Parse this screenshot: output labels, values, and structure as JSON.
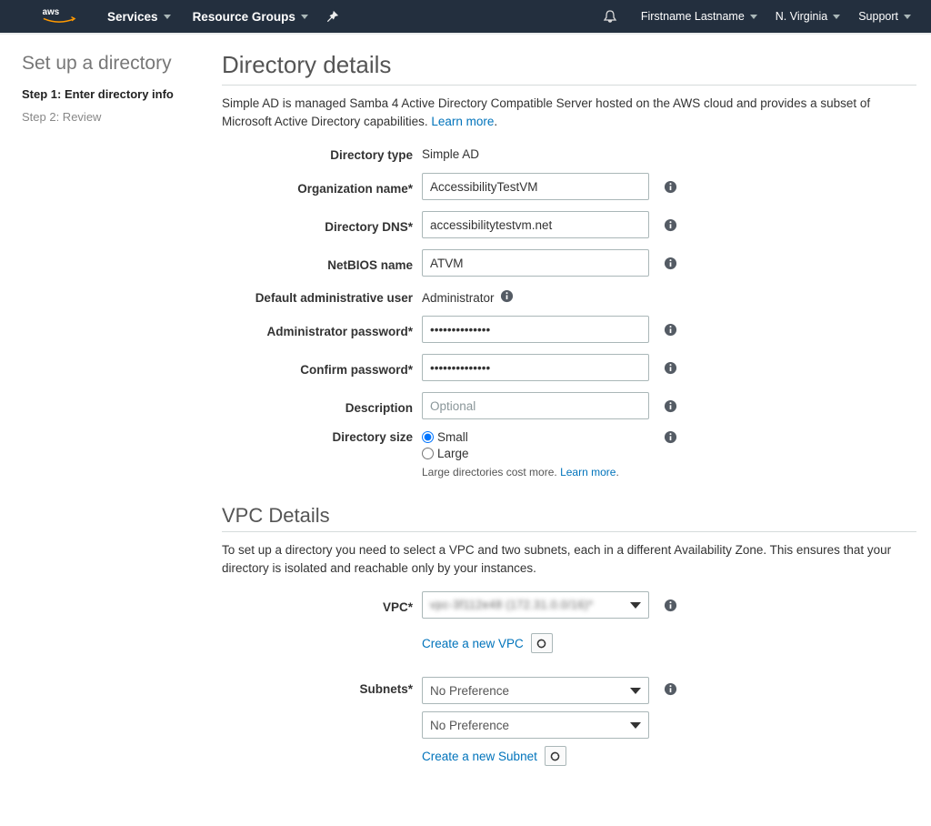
{
  "nav": {
    "services": "Services",
    "resource_groups": "Resource Groups",
    "user": "Firstname Lastname",
    "region": "N. Virginia",
    "support": "Support"
  },
  "sidebar": {
    "title": "Set up a directory",
    "steps": [
      {
        "label": "Step 1: Enter directory info"
      },
      {
        "label": "Step 2: Review"
      }
    ]
  },
  "main": {
    "heading": "Directory details",
    "intro": "Simple AD is managed Samba 4 Active Directory Compatible Server hosted on the AWS cloud and provides a subset of Microsoft Active Directory capabilities. ",
    "learn_more": "Learn more",
    "fields": {
      "directory_type_label": "Directory type",
      "directory_type_value": "Simple AD",
      "org_name_label": "Organization name*",
      "org_name_value": "AccessibilityTestVM",
      "dns_label": "Directory DNS*",
      "dns_value": "accessibilitytestvm.net",
      "netbios_label": "NetBIOS name",
      "netbios_value": "ATVM",
      "admin_user_label": "Default administrative user",
      "admin_user_value": "Administrator",
      "admin_pass_label": "Administrator password*",
      "admin_pass_value": "••••••••••••••",
      "confirm_pass_label": "Confirm password*",
      "confirm_pass_value": "••••••••••••••",
      "description_label": "Description",
      "description_placeholder": "Optional",
      "dir_size_label": "Directory size",
      "size_small": "Small",
      "size_large": "Large",
      "size_note_prefix": "Large directories cost more. ",
      "size_note_link": "Learn more"
    },
    "vpc": {
      "heading": "VPC Details",
      "intro": "To set up a directory you need to select a VPC and two subnets, each in a different Availability Zone. This ensures that your directory is isolated and reachable only by your instances.",
      "vpc_label": "VPC*",
      "vpc_value": "vpc-3f112e48 (172.31.0.0/16)*",
      "create_vpc": "Create a new VPC",
      "subnets_label": "Subnets*",
      "subnet1_value": "No Preference",
      "subnet2_value": "No Preference",
      "create_subnet": "Create a new Subnet"
    }
  }
}
